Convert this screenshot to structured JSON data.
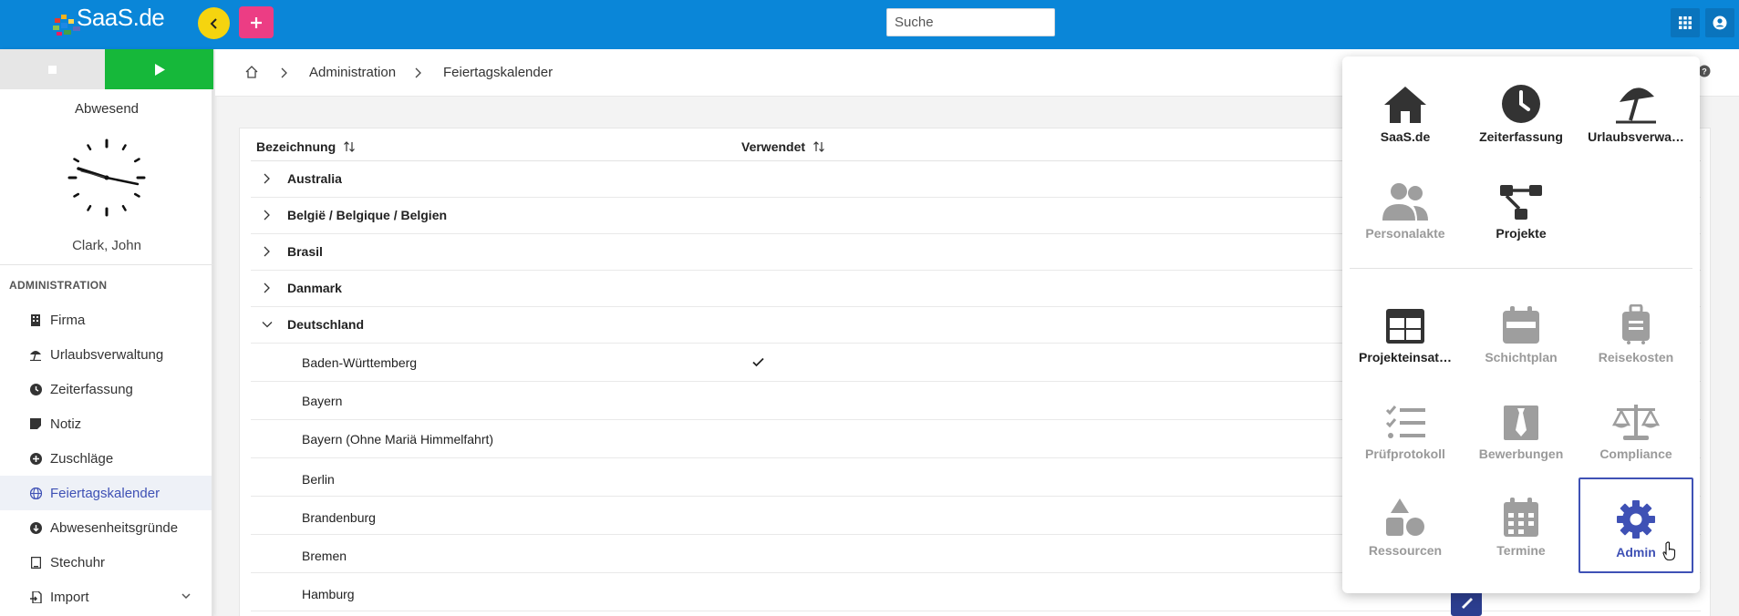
{
  "topbar": {
    "logo_text": "SaaS.de",
    "search_placeholder": "Suche",
    "search_value": "",
    "icons": [
      "chevron-left-icon",
      "plus-icon",
      "apps-grid-icon",
      "account-circle-icon"
    ],
    "colors": {
      "bar": "#0a86d8",
      "back_button": "#f5d40f",
      "add_button": "#ec3d84"
    }
  },
  "sidebar": {
    "status": "Abwesend",
    "user": "Clark, John",
    "section": "ADMINISTRATION",
    "items": [
      {
        "label": "Firma",
        "icon": "building-icon"
      },
      {
        "label": "Urlaubsverwaltung",
        "icon": "beach-umbrella-icon"
      },
      {
        "label": "Zeiterfassung",
        "icon": "clock-icon"
      },
      {
        "label": "Notiz",
        "icon": "note-icon"
      },
      {
        "label": "Zuschläge",
        "icon": "plus-circle-icon"
      },
      {
        "label": "Feiertagskalender",
        "icon": "globe-icon",
        "active": true
      },
      {
        "label": "Abwesenheitsgründe",
        "icon": "arrow-down-circle-icon"
      },
      {
        "label": "Stechuhr",
        "icon": "tablet-icon"
      },
      {
        "label": "Import",
        "icon": "file-import-icon",
        "expandable": true
      }
    ]
  },
  "breadcrumb": {
    "home_icon": "home-icon",
    "items": [
      "Administration",
      "Feiertagskalender"
    ]
  },
  "table": {
    "columns": [
      "Bezeichnung",
      "Verwendet"
    ],
    "rows": [
      {
        "label": "Australia",
        "type": "group",
        "expanded": false
      },
      {
        "label": "België / Belgique / Belgien",
        "type": "group",
        "expanded": false
      },
      {
        "label": "Brasil",
        "type": "group",
        "expanded": false
      },
      {
        "label": "Danmark",
        "type": "group",
        "expanded": false
      },
      {
        "label": "Deutschland",
        "type": "group",
        "expanded": true
      },
      {
        "label": "Baden-Württemberg",
        "type": "sub",
        "used": true
      },
      {
        "label": "Bayern",
        "type": "sub",
        "used": false
      },
      {
        "label": "Bayern (Ohne Mariä Himmelfahrt)",
        "type": "sub",
        "used": false
      },
      {
        "label": "Berlin",
        "type": "sub",
        "used": false
      },
      {
        "label": "Brandenburg",
        "type": "sub",
        "used": false
      },
      {
        "label": "Bremen",
        "type": "sub",
        "used": false
      },
      {
        "label": "Hamburg",
        "type": "sub",
        "used": false
      }
    ]
  },
  "apps_menu": {
    "top": [
      {
        "label": "SaaS.de",
        "icon": "home-icon",
        "enabled": true
      },
      {
        "label": "Zeiterfassung",
        "icon": "clock-icon",
        "enabled": true
      },
      {
        "label": "Urlaubsverwa…",
        "icon": "beach-umbrella-icon",
        "enabled": true
      },
      {
        "label": "Personalakte",
        "icon": "people-icon",
        "enabled": false
      },
      {
        "label": "Projekte",
        "icon": "project-tree-icon",
        "enabled": true
      }
    ],
    "bottom": [
      {
        "label": "Projekteinsat…",
        "icon": "table-grid-icon",
        "enabled": true
      },
      {
        "label": "Schichtplan",
        "icon": "calendar-icon",
        "enabled": false
      },
      {
        "label": "Reisekosten",
        "icon": "suitcase-icon",
        "enabled": false
      },
      {
        "label": "Prüfprotokoll",
        "icon": "checklist-icon",
        "enabled": false
      },
      {
        "label": "Bewerbungen",
        "icon": "tie-icon",
        "enabled": false
      },
      {
        "label": "Compliance",
        "icon": "scale-icon",
        "enabled": false
      },
      {
        "label": "Ressourcen",
        "icon": "shapes-icon",
        "enabled": false
      },
      {
        "label": "Termine",
        "icon": "calendar-grid-icon",
        "enabled": false
      },
      {
        "label": "Admin",
        "icon": "gear-icon",
        "enabled": true,
        "selected": true
      }
    ],
    "colors": {
      "active_icon": "#333333",
      "dim_icon": "#9e9e9e",
      "selected": "#3f51b5"
    }
  }
}
